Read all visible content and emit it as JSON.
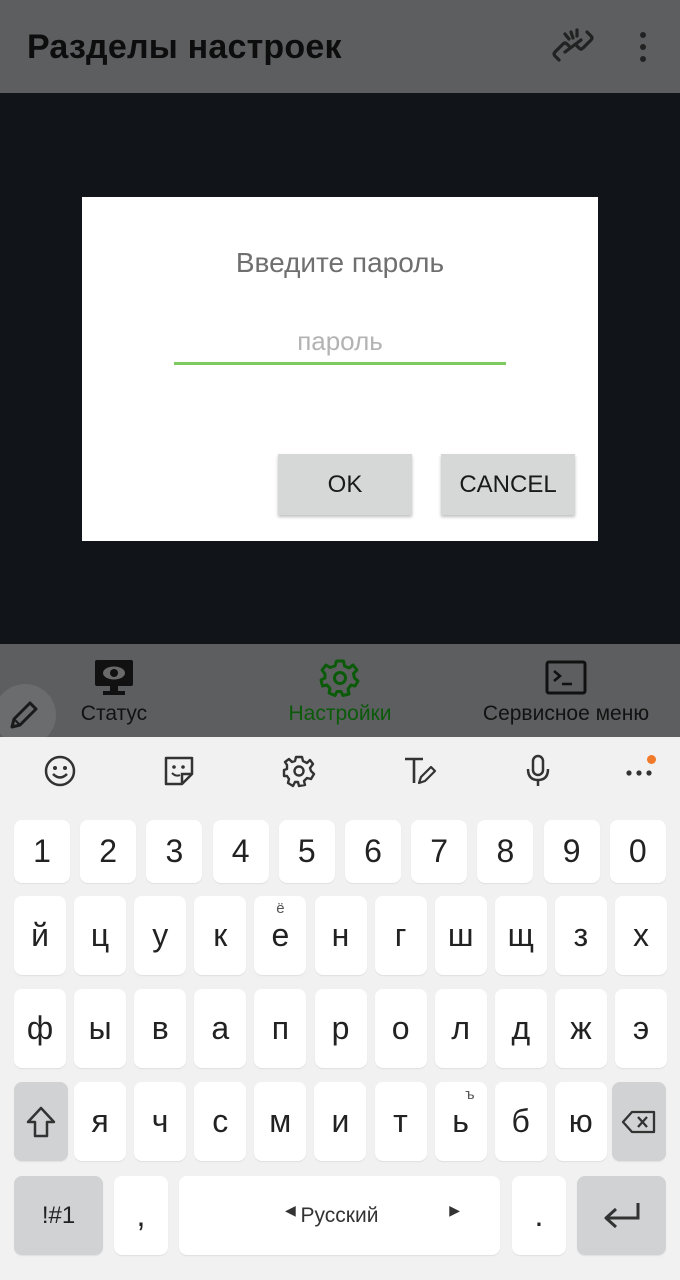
{
  "appbar": {
    "title": "Разделы настроек",
    "link_icon": "link-broken-icon",
    "menu_icon": "more-vert-icon"
  },
  "dialog": {
    "title": "Введите пароль",
    "password_placeholder": "пароль",
    "password_value": "",
    "ok_label": "OK",
    "cancel_label": "CANCEL"
  },
  "bottom_nav": {
    "items": [
      {
        "label": "Статус",
        "icon": "monitor-eye-icon",
        "active": false
      },
      {
        "label": "Настройки",
        "icon": "gear-icon",
        "active": true
      },
      {
        "label": "Сервисное меню",
        "icon": "terminal-icon",
        "active": false
      }
    ]
  },
  "keyboard": {
    "toolbar_icons": [
      "emoji-icon",
      "sticker-icon",
      "settings-icon",
      "text-edit-icon",
      "microphone-icon",
      "more-icon"
    ],
    "row_digits": [
      "1",
      "2",
      "3",
      "4",
      "5",
      "6",
      "7",
      "8",
      "9",
      "0"
    ],
    "row1": [
      "й",
      "ц",
      "у",
      "к",
      "е",
      "н",
      "г",
      "ш",
      "щ",
      "з",
      "х"
    ],
    "row1_alt_e": "ё",
    "row2": [
      "ф",
      "ы",
      "в",
      "а",
      "п",
      "р",
      "о",
      "л",
      "д",
      "ж",
      "э"
    ],
    "row3": [
      "я",
      "ч",
      "с",
      "м",
      "и",
      "т",
      "ь",
      "б",
      "ю"
    ],
    "row3_alt_soft": "ъ",
    "symbols_label": "!#1",
    "comma_label": ",",
    "space_label": "Русский",
    "period_label": "."
  },
  "colors": {
    "accent_green": "#7dcb5f",
    "active_nav": "#0a5a0a",
    "notification_dot": "#f07a2a"
  }
}
